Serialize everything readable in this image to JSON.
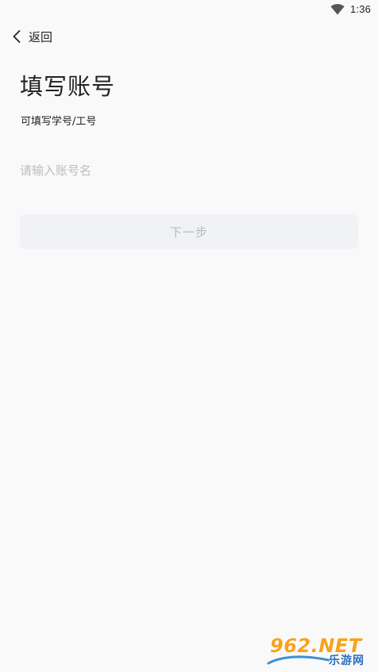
{
  "status_bar": {
    "time": "1:36",
    "wifi_icon": "wifi-icon"
  },
  "nav": {
    "back_label": "返回",
    "back_icon": "chevron-left-icon"
  },
  "page": {
    "title": "填写账号",
    "subtitle": "可填写学号/工号"
  },
  "form": {
    "account_input": {
      "value": "",
      "placeholder": "请输入账号名"
    },
    "next_button_label": "下一步"
  },
  "watermark": {
    "main": "962.NET",
    "sub": "乐游网"
  },
  "colors": {
    "background": "#f9f9f9",
    "button_disabled_bg": "#f1f2f6",
    "button_disabled_text": "#b9b9b9",
    "placeholder": "#bdbdbd"
  }
}
